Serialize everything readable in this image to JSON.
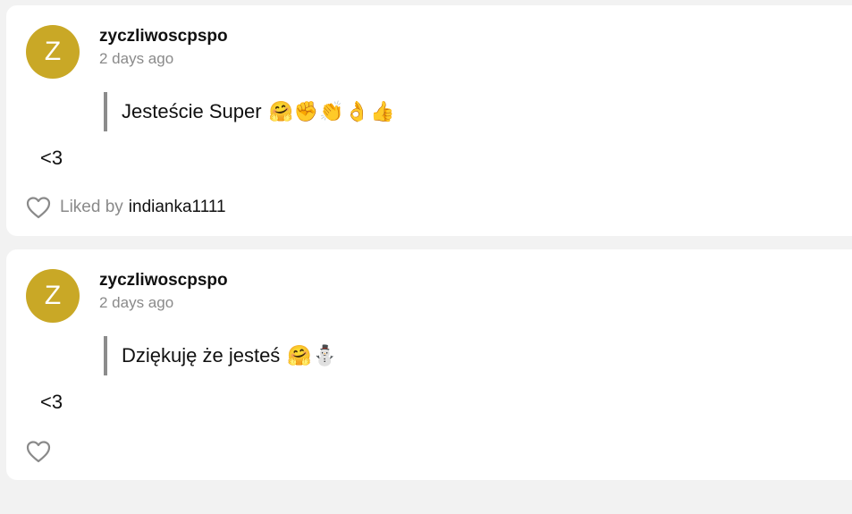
{
  "posts": [
    {
      "avatar_letter": "Z",
      "avatar_color": "#c9a826",
      "username": "zyczliwoscpspo",
      "time": "2 days ago",
      "quote_text": "Jesteście Super",
      "quote_emojis": "🤗✊👏👌👍",
      "body": "<3",
      "liked_by_label": "Liked by",
      "liked_by_user": "indianka1111"
    },
    {
      "avatar_letter": "Z",
      "avatar_color": "#c9a826",
      "username": "zyczliwoscpspo",
      "time": "2 days ago",
      "quote_text": "Dziękuję że jesteś",
      "quote_emojis": "🤗⛄",
      "body": "<3"
    }
  ],
  "icons": {
    "like": "heart-outline-icon"
  }
}
